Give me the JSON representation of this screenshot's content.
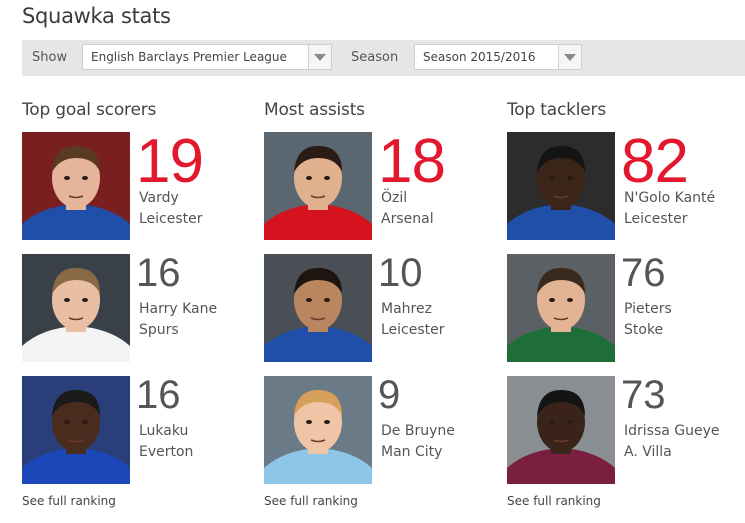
{
  "title": "Squawka stats",
  "filters": {
    "show_label": "Show",
    "show_value": "English Barclays Premier League",
    "season_label": "Season",
    "season_value": "Season 2015/2016"
  },
  "columns": [
    {
      "title": "Top goal scorers",
      "see_full": "See full ranking",
      "players": [
        {
          "value": "19",
          "name": "Vardy",
          "team": "Leicester",
          "kit": "#1f4fa8",
          "skin": "#e6b49a",
          "hair": "#5a3a22",
          "bg": "#7a1f1f"
        },
        {
          "value": "16",
          "name": "Harry Kane",
          "team": "Spurs",
          "kit": "#f4f4f4",
          "skin": "#e9bfa3",
          "hair": "#8a6a44",
          "bg": "#3a4048"
        },
        {
          "value": "16",
          "name": "Lukaku",
          "team": "Everton",
          "kit": "#1c47b8",
          "skin": "#4a2c1f",
          "hair": "#1a1a1a",
          "bg": "#2a3f7a"
        }
      ]
    },
    {
      "title": "Most assists",
      "see_full": "See full ranking",
      "players": [
        {
          "value": "18",
          "name": "Özil",
          "team": "Arsenal",
          "kit": "#d4131f",
          "skin": "#e1b08e",
          "hair": "#2a1c14",
          "bg": "#5b6770"
        },
        {
          "value": "10",
          "name": "Mahrez",
          "team": "Leicester",
          "kit": "#1f4fa8",
          "skin": "#b8865f",
          "hair": "#1f1510",
          "bg": "#4a4e55"
        },
        {
          "value": "9",
          "name": "De Bruyne",
          "team": "Man City",
          "kit": "#8ec6ea",
          "skin": "#f0c4a6",
          "hair": "#d7a05a",
          "bg": "#6a7a86"
        }
      ]
    },
    {
      "title": "Top tacklers",
      "see_full": "See full ranking",
      "players": [
        {
          "value": "82",
          "name": "N'Golo Kanté",
          "team": "Leicester",
          "kit": "#1f4fa8",
          "skin": "#3b2418",
          "hair": "#141414",
          "bg": "#2c2c2c"
        },
        {
          "value": "76",
          "name": "Pieters",
          "team": "Stoke",
          "kit": "#1f6e3a",
          "skin": "#e3b395",
          "hair": "#3a2a1e",
          "bg": "#5b6064"
        },
        {
          "value": "73",
          "name": "Idrissa Gueye",
          "team": "A. Villa",
          "kit": "#7a1f3d",
          "skin": "#3a2419",
          "hair": "#141414",
          "bg": "#8a8f94"
        }
      ]
    }
  ]
}
